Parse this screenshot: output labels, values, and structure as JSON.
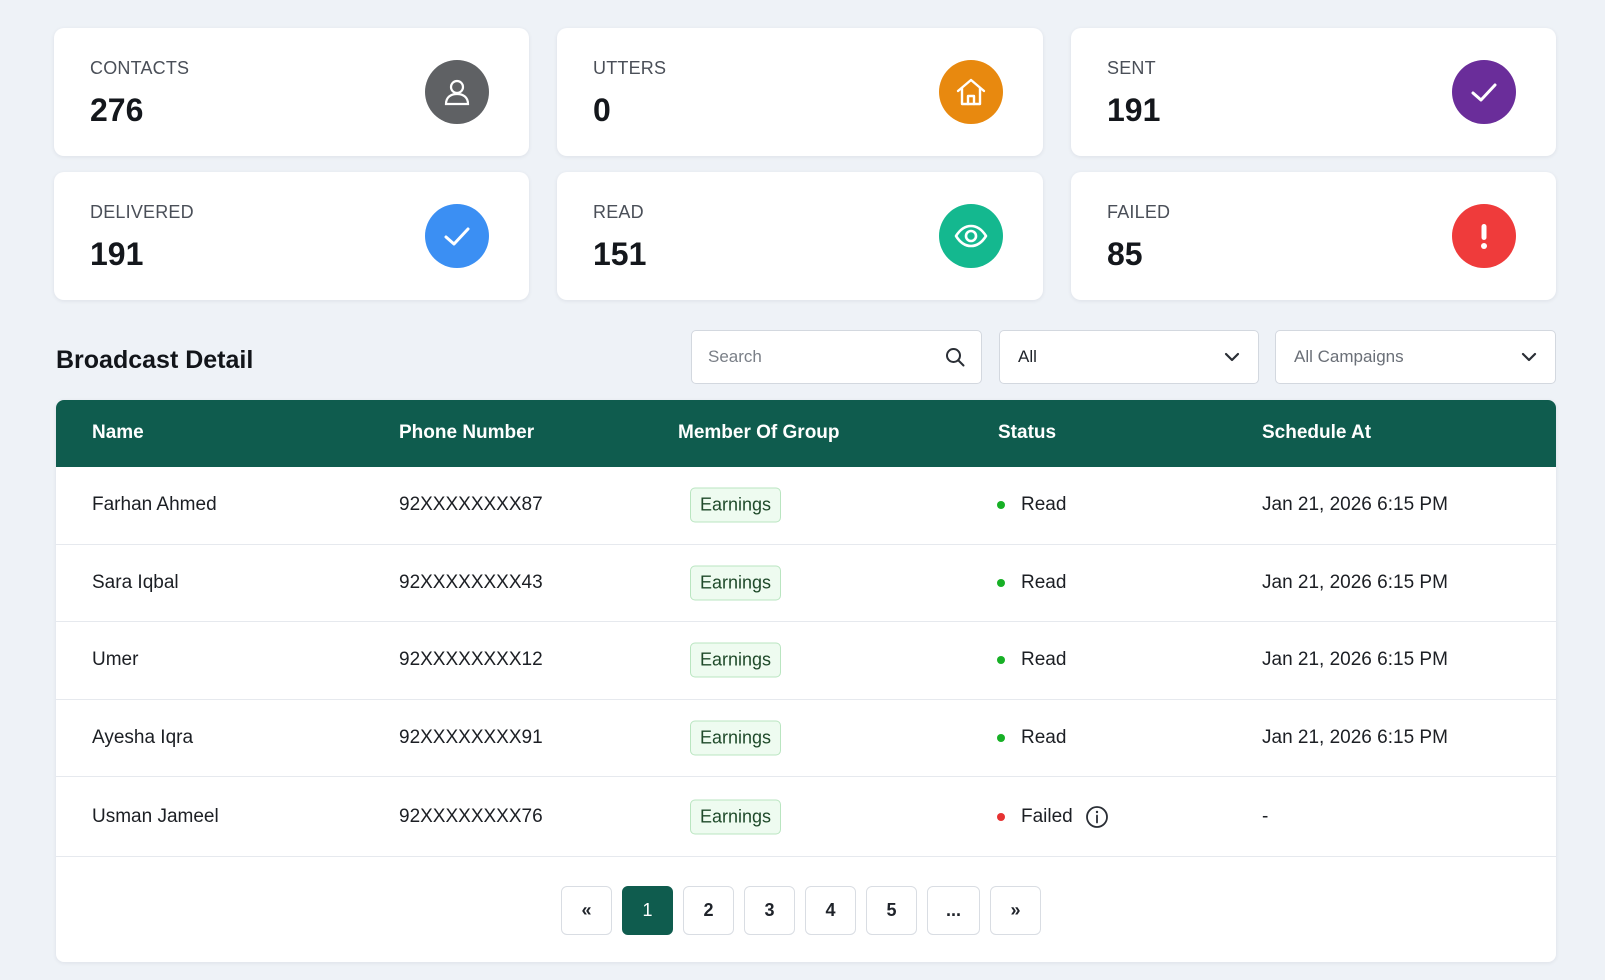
{
  "stats": [
    {
      "label": "CONTACTS",
      "value": "276",
      "icon": "user-icon",
      "color": "#5f6164"
    },
    {
      "label": "UTTERS",
      "value": "0",
      "icon": "home-icon",
      "color": "#e8890f"
    },
    {
      "label": "SENT",
      "value": "191",
      "icon": "check-icon",
      "color": "#6a2d9a"
    },
    {
      "label": "DELIVERED",
      "value": "191",
      "icon": "check-icon",
      "color": "#3b8ff3"
    },
    {
      "label": "READ",
      "value": "151",
      "icon": "eye-icon",
      "color": "#14b88f"
    },
    {
      "label": "FAILED",
      "value": "85",
      "icon": "exclamation-icon",
      "color": "#ef3b3b"
    }
  ],
  "broadcast": {
    "title": "Broadcast Detail",
    "search_placeholder": "Search",
    "status_filter": "All",
    "campaign_filter": "All Campaigns"
  },
  "table": {
    "headers": {
      "name": "Name",
      "phone": "Phone Number",
      "group": "Member Of Group",
      "status": "Status",
      "schedule": "Schedule At"
    },
    "rows": [
      {
        "name": "Farhan Ahmed",
        "phone": "92XXXXXXXX87",
        "group": "Earnings",
        "status": "Read",
        "schedule": "Jan 21, 2026 6:15 PM"
      },
      {
        "name": "Sara Iqbal",
        "phone": "92XXXXXXXX43",
        "group": "Earnings",
        "status": "Read",
        "schedule": "Jan 21, 2026 6:15 PM"
      },
      {
        "name": "Umer",
        "phone": "92XXXXXXXX12",
        "group": "Earnings",
        "status": "Read",
        "schedule": "Jan 21, 2026 6:15 PM"
      },
      {
        "name": "Ayesha Iqra",
        "phone": "92XXXXXXXX91",
        "group": "Earnings",
        "status": "Read",
        "schedule": "Jan 21, 2026 6:15 PM"
      },
      {
        "name": "Usman Jameel",
        "phone": "92XXXXXXXX76",
        "group": "Earnings",
        "status": "Failed",
        "schedule": "-"
      }
    ]
  },
  "status_colors": {
    "read": "#17b026",
    "failed": "#e63232"
  },
  "header_color": "#0f5c4e",
  "pagination": {
    "prev": "«",
    "pages": [
      "1",
      "2",
      "3",
      "4",
      "5"
    ],
    "ellipsis": "...",
    "next": "»",
    "current": "1"
  }
}
